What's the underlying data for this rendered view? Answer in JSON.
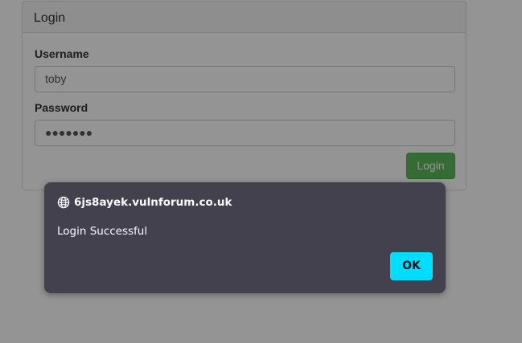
{
  "panel": {
    "title": "Login",
    "username_label": "Username",
    "username_value": "toby",
    "password_label": "Password",
    "password_value": "●●●●●●●",
    "login_button": "Login",
    "login_button_color": "#5cb85c"
  },
  "dialog": {
    "origin": "6js8ayek.vulnforum.co.uk",
    "origin_icon": "globe-icon",
    "message": "Login Successful",
    "ok_button": "OK",
    "ok_button_color": "#00ddff",
    "background_color": "#42414d"
  }
}
